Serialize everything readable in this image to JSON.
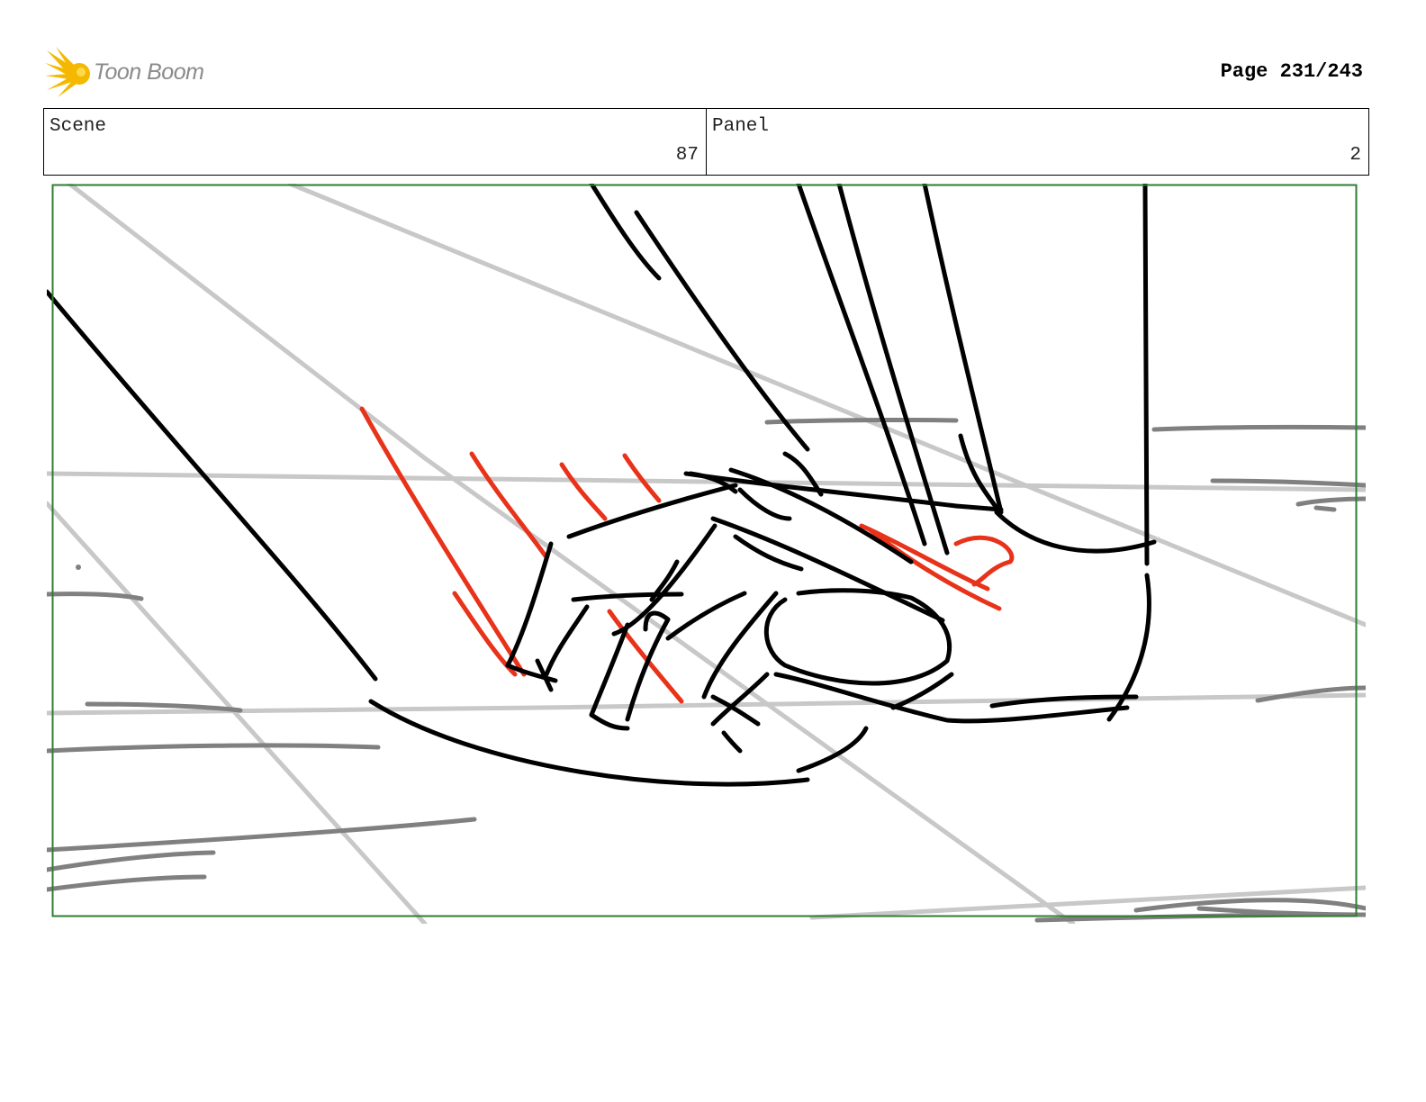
{
  "header": {
    "brand": "Toon Boom",
    "logo_icon": "starburst-logo-icon",
    "page_label": "Page 231/243"
  },
  "info": {
    "scene_label": "Scene",
    "scene_value": "87",
    "panel_label": "Panel",
    "panel_value": "2"
  },
  "colors": {
    "frame_border": "#2e7d32",
    "sketch_black": "#000000",
    "sketch_red": "#e8321a",
    "guide_light": "#c8c8c8",
    "guide_dark": "#808080",
    "logo_yellow": "#f5b800"
  }
}
